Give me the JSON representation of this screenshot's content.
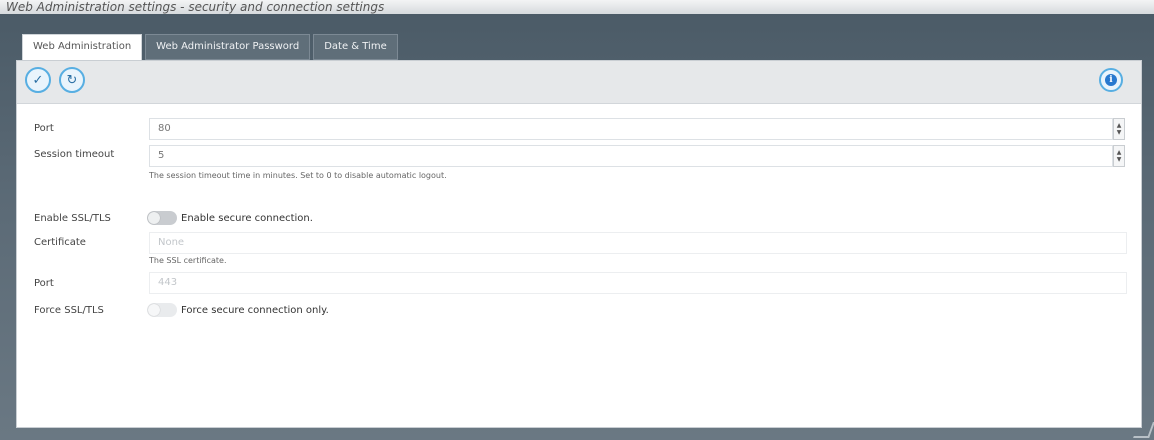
{
  "header": {
    "caption": "Web Administration settings - security and connection settings"
  },
  "tabs": [
    {
      "label": "Web Administration",
      "active": true
    },
    {
      "label": "Web Administrator Password",
      "active": false
    },
    {
      "label": "Date & Time",
      "active": false
    }
  ],
  "toolbar": {
    "save_icon": "check-icon",
    "refresh_icon": "refresh-icon",
    "info_icon": "info-icon"
  },
  "form": {
    "port_label": "Port",
    "port_value": "80",
    "session_timeout_label": "Session timeout",
    "session_timeout_value": "5",
    "session_timeout_help": "The session timeout time in minutes. Set to 0 to disable automatic logout.",
    "ssl_label": "Enable SSL/TLS",
    "ssl_toggle_label": "Enable secure connection.",
    "ssl_enabled": false,
    "certificate_label": "Certificate",
    "certificate_value": "None",
    "certificate_help": "The SSL certificate.",
    "ssl_port_label": "Port",
    "ssl_port_value": "443",
    "force_ssl_label": "Force SSL/TLS",
    "force_ssl_toggle_label": "Force secure connection only.",
    "force_ssl_enabled": false
  },
  "colors": {
    "accent": "#57aee2",
    "frame": "#5b6a76",
    "toolbar": "#e6e8ea"
  }
}
